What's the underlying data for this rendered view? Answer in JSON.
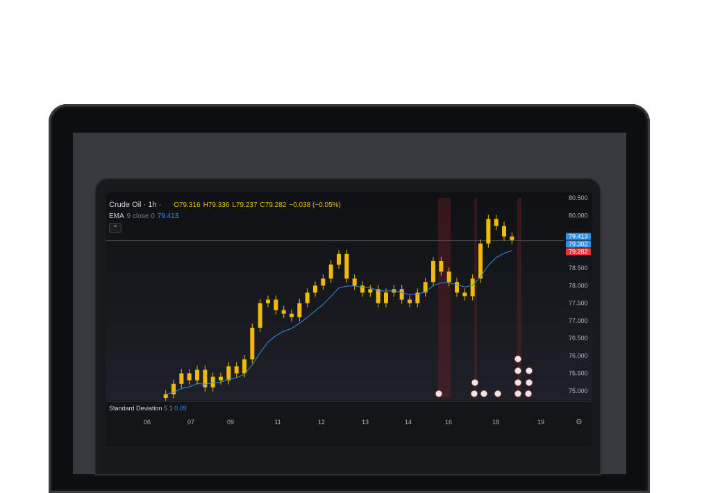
{
  "legend": {
    "symbol": "Crude Oil · 1h ·",
    "open": "O79.316",
    "high": "H79.336",
    "low": "L79.237",
    "close": "C79.282",
    "change": "−0.038 (−0.05%)",
    "ema_name": "EMA",
    "ema_params": "9 close 0",
    "ema_value": "79.413",
    "collapse_icon": "chevron-up-icon"
  },
  "price_axis": {
    "ticks": [
      "80.500",
      "80.000",
      "79.000",
      "78.500",
      "78.000",
      "77.500",
      "77.000",
      "76.500",
      "76.000",
      "75.500",
      "75.000"
    ],
    "badges": [
      {
        "value": "79.413",
        "color": "#2f8fe8"
      },
      {
        "value": "79.302",
        "color": "#2f8fe8"
      },
      {
        "value": "79.282",
        "color": "#e53935"
      }
    ]
  },
  "indicator": {
    "name": "Standard Deviation",
    "params": "5 1",
    "value": "0.09"
  },
  "time_axis": {
    "ticks": [
      "06",
      "07",
      "09",
      "11",
      "12",
      "13",
      "14",
      "16",
      "18",
      "19"
    ],
    "settings_icon": "gear-icon"
  },
  "colors": {
    "candle": "#f0b90b",
    "ema": "#2f8fe8",
    "event_band": "#7a1f24"
  },
  "chart_data": {
    "type": "candlestick",
    "series": [
      {
        "name": "Crude Oil",
        "values_close": [
          74.9,
          75.2,
          75.5,
          75.3,
          75.6,
          75.1,
          75.4,
          75.3,
          75.7,
          75.5,
          75.9,
          76.8,
          77.5,
          77.6,
          77.3,
          77.2,
          77.1,
          77.5,
          77.8,
          78.0,
          78.2,
          78.6,
          78.9,
          78.2,
          78.0,
          77.8,
          77.9,
          77.5,
          77.8,
          77.9,
          77.6,
          77.5,
          77.8,
          78.1,
          78.7,
          78.4,
          78.1,
          77.8,
          77.7,
          78.2,
          79.2,
          79.9,
          79.7,
          79.4,
          79.3
        ]
      },
      {
        "name": "EMA",
        "values": []
      }
    ],
    "ylim": [
      74.8,
      80.5
    ]
  }
}
